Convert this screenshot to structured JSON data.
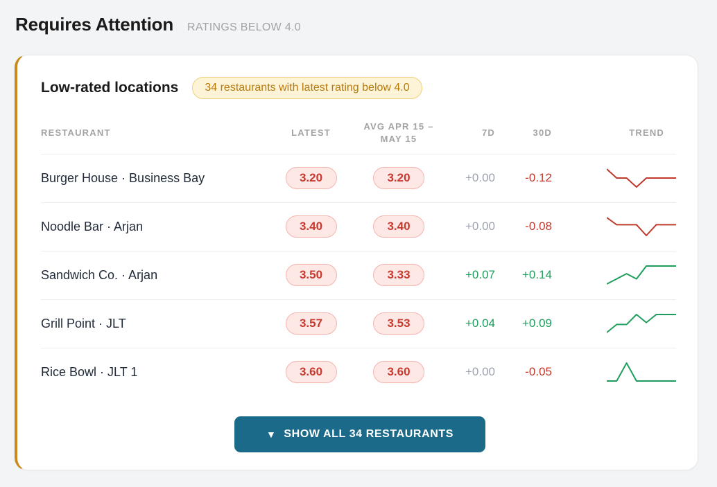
{
  "section": {
    "title": "Requires Attention",
    "subtitle": "RATINGS BELOW 4.0"
  },
  "card": {
    "title": "Low-rated locations",
    "count_badge": "34 restaurants with latest rating below 4.0",
    "accent_color": "#c88a1d"
  },
  "table": {
    "headers": {
      "restaurant": "RESTAURANT",
      "latest": "LATEST",
      "avg_line1": "AVG APR 15 –",
      "avg_line2": "MAY 15",
      "d7": "7D",
      "d30": "30D",
      "trend": "TREND"
    },
    "rows": [
      {
        "name": "Burger House · Business Bay",
        "latest": "3.20",
        "avg": "3.20",
        "d7": "+0.00",
        "d7_tone": "neutral",
        "d30": "-0.12",
        "d30_tone": "neg",
        "trend_color": "#c0392b",
        "trend": [
          3.32,
          3.26,
          3.26,
          3.2,
          3.26,
          3.26,
          3.26,
          3.26
        ]
      },
      {
        "name": "Noodle Bar · Arjan",
        "latest": "3.40",
        "avg": "3.40",
        "d7": "+0.00",
        "d7_tone": "neutral",
        "d30": "-0.08",
        "d30_tone": "neg",
        "trend_color": "#c0392b",
        "trend": [
          3.48,
          3.44,
          3.44,
          3.44,
          3.38,
          3.44,
          3.44,
          3.44
        ]
      },
      {
        "name": "Sandwich Co. · Arjan",
        "latest": "3.50",
        "avg": "3.33",
        "d7": "+0.07",
        "d7_tone": "pos",
        "d30": "+0.14",
        "d30_tone": "pos",
        "trend_color": "#1e9d5c",
        "trend": [
          3.36,
          3.4,
          3.44,
          3.4,
          3.5,
          3.5,
          3.5,
          3.5
        ]
      },
      {
        "name": "Grill Point · JLT",
        "latest": "3.57",
        "avg": "3.53",
        "d7": "+0.04",
        "d7_tone": "pos",
        "d30": "+0.09",
        "d30_tone": "pos",
        "trend_color": "#1e9d5c",
        "trend": [
          3.48,
          3.52,
          3.52,
          3.57,
          3.53,
          3.57,
          3.57,
          3.57
        ]
      },
      {
        "name": "Rice Bowl · JLT 1",
        "latest": "3.60",
        "avg": "3.60",
        "d7": "+0.00",
        "d7_tone": "neutral",
        "d30": "-0.05",
        "d30_tone": "neg",
        "trend_color": "#1e9d5c",
        "trend": [
          3.6,
          3.6,
          3.65,
          3.6,
          3.6,
          3.6,
          3.6,
          3.6
        ]
      }
    ]
  },
  "actions": {
    "show_all_caret": "▼",
    "show_all_label": "SHOW ALL 34 RESTAURANTS"
  }
}
